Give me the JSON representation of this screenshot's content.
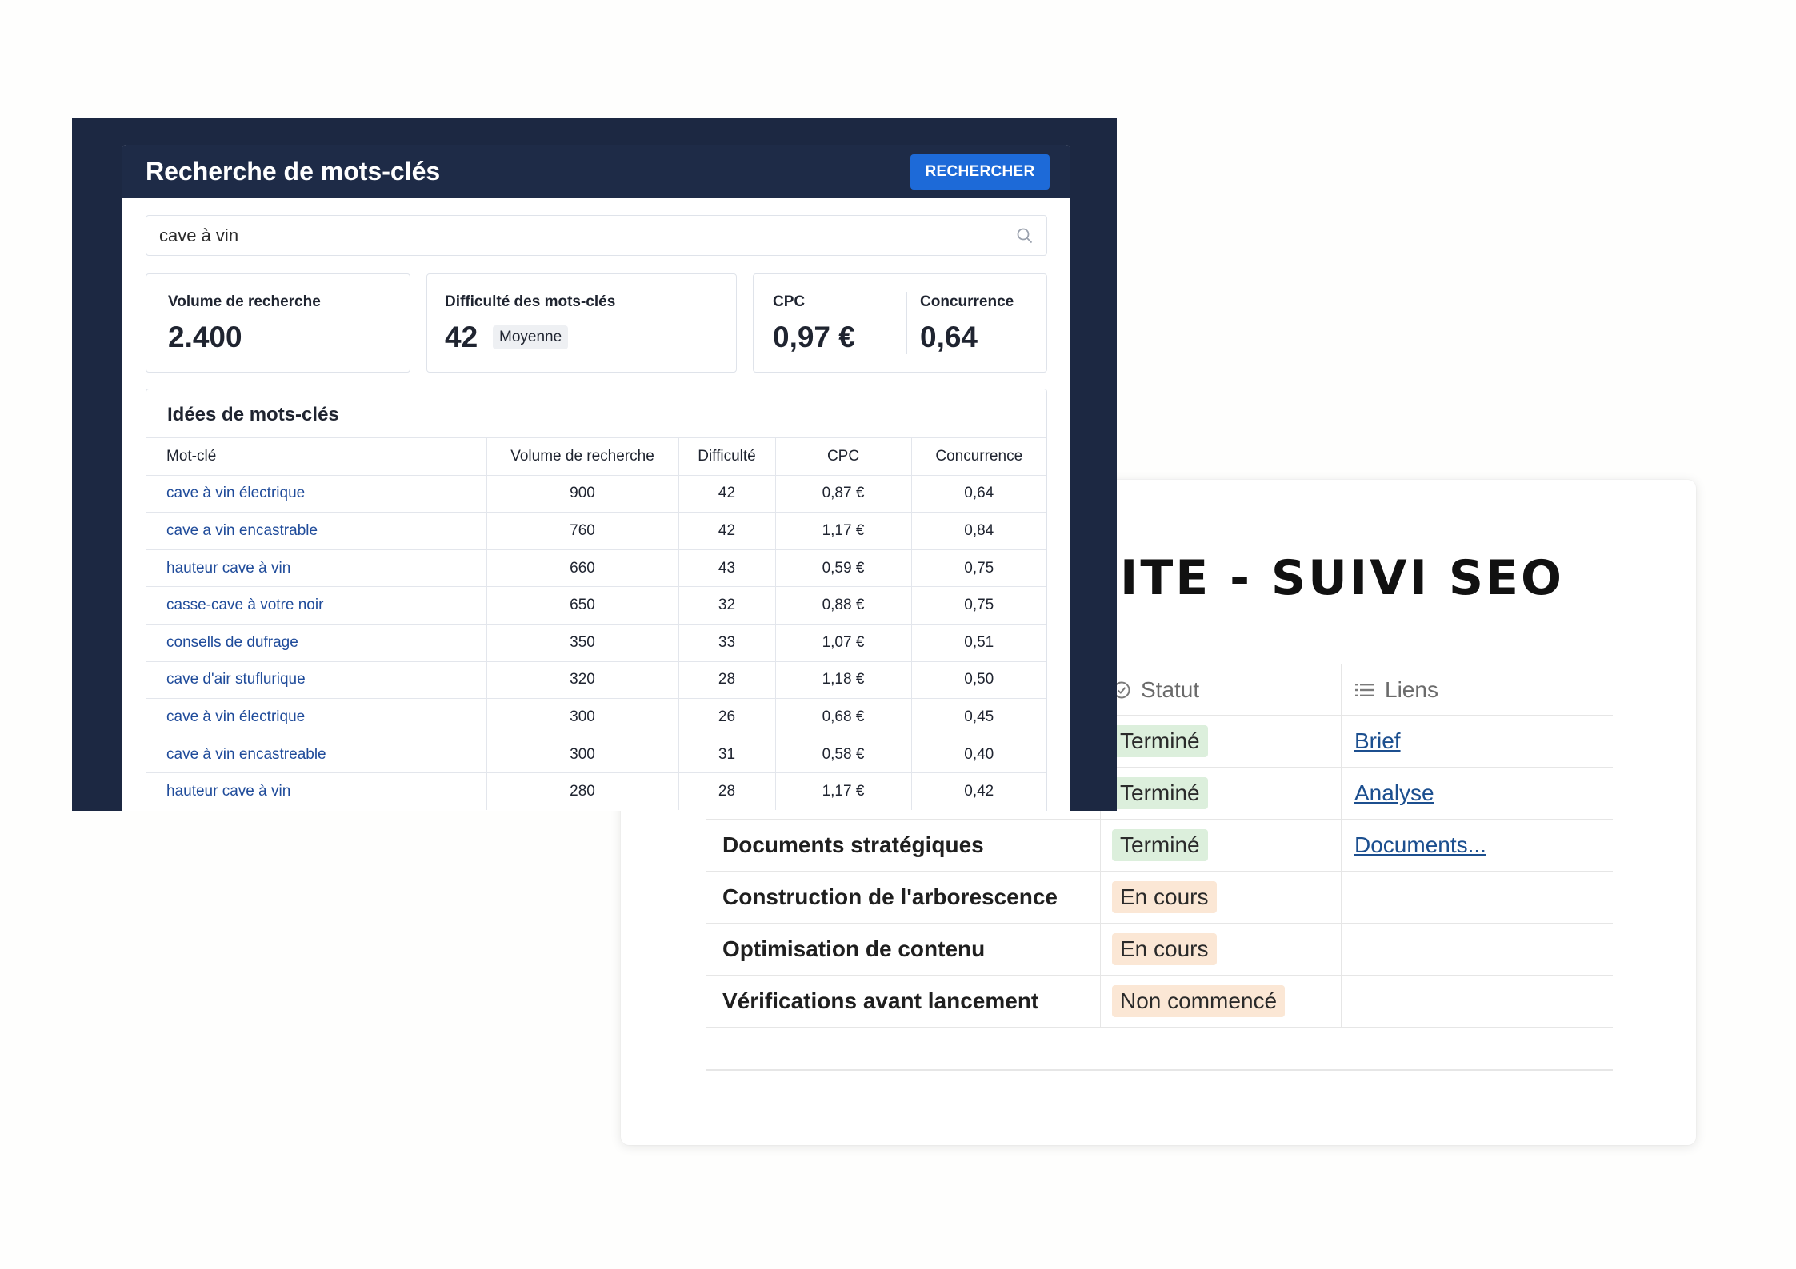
{
  "seo": {
    "title": "ITE - SUIVI SEO",
    "headers": {
      "status": "Statut",
      "links": "Liens"
    },
    "rows": [
      {
        "task": "",
        "status": "Terminé",
        "status_type": "done",
        "link": "Brief"
      },
      {
        "task": "",
        "status": "Terminé",
        "status_type": "done",
        "link": "Analyse"
      },
      {
        "task": "Documents stratégiques",
        "status": "Terminé",
        "status_type": "done",
        "link": "Documents..."
      },
      {
        "task": "Construction de l'arborescence",
        "status": "En cours",
        "status_type": "progress",
        "link": ""
      },
      {
        "task": "Optimisation de contenu",
        "status": "En cours",
        "status_type": "progress",
        "link": ""
      },
      {
        "task": "Vérifications avant lancement",
        "status": "Non commencé",
        "status_type": "notstarted",
        "link": ""
      }
    ]
  },
  "kw": {
    "title": "Recherche de mots-clés",
    "search_button": "RECHERCHER",
    "search_value": "cave à vin",
    "metrics": {
      "volume_label": "Volume de recherche",
      "volume_value": "2.400",
      "difficulty_label": "Difficulté des mots-clés",
      "difficulty_value": "42",
      "difficulty_badge": "Moyenne",
      "cpc_label": "CPC",
      "cpc_value": "0,97 €",
      "competition_label": "Concurrence",
      "competition_value": "0,64"
    },
    "ideas_title": "Idées de mots-clés",
    "columns": [
      "Mot-clé",
      "Volume de recherche",
      "Difficulté",
      "CPC",
      "Concurrence"
    ],
    "rows": [
      [
        "cave à vin électrique",
        "900",
        "42",
        "0,87 €",
        "0,64"
      ],
      [
        "cave a vin encastrable",
        "760",
        "42",
        "1,17 €",
        "0,84"
      ],
      [
        "hauteur cave à vin",
        "660",
        "43",
        "0,59 €",
        "0,75"
      ],
      [
        "casse-cave à votre noir",
        "650",
        "32",
        "0,88 €",
        "0,75"
      ],
      [
        "consells de dufrage",
        "350",
        "33",
        "1,07 €",
        "0,51"
      ],
      [
        "cave d'air stuflurique",
        "320",
        "28",
        "1,18 €",
        "0,50"
      ],
      [
        "cave à vin électrique",
        "300",
        "26",
        "0,68 €",
        "0,45"
      ],
      [
        "cave à vin encastreable",
        "300",
        "31",
        "0,58 €",
        "0,40"
      ],
      [
        "hauteur cave à vin",
        "280",
        "28",
        "1,17 €",
        "0,42"
      ]
    ]
  },
  "colors": {
    "navy": "#1c2842",
    "accent": "#1d6ad8",
    "link": "#1f4b9a",
    "done": "#dcefdc",
    "progress": "#fbe7d5"
  },
  "icons": {
    "status": "check-circle-icon",
    "links": "list-icon",
    "search": "magnifier-icon"
  }
}
